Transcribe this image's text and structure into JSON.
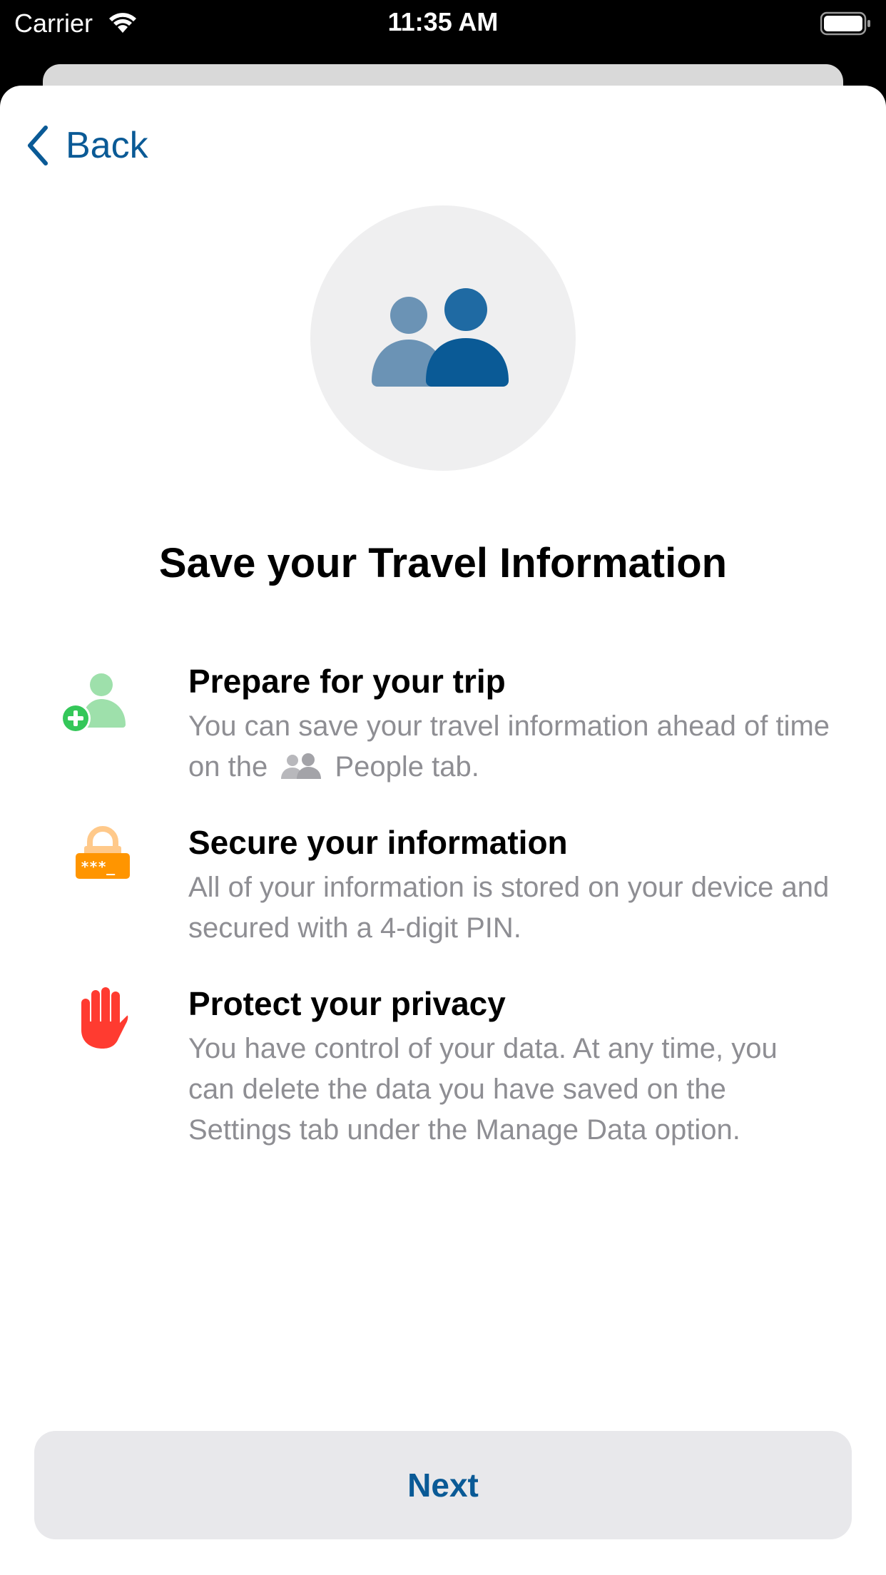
{
  "status_bar": {
    "carrier": "Carrier",
    "time": "11:35 AM"
  },
  "nav": {
    "back_label": "Back"
  },
  "hero": {
    "icon": "people-icon"
  },
  "page": {
    "title": "Save your Travel Information"
  },
  "features": [
    {
      "icon": "add-person-icon",
      "title": "Prepare for your trip",
      "desc_before": "You can save your travel information ahead of time on the",
      "desc_inline_icon": "people-icon",
      "desc_after": "People tab."
    },
    {
      "icon": "pin-lock-icon",
      "title": "Secure your information",
      "desc": "All of your information is stored on your device and secured with a 4-digit PIN."
    },
    {
      "icon": "stop-hand-icon",
      "title": "Protect your privacy",
      "desc": "You have control of your data. At any time, you can delete the data you have saved on the Settings tab under the Manage Data option."
    }
  ],
  "actions": {
    "next_label": "Next"
  },
  "colors": {
    "accent": "#0a5a96",
    "hero_person_back": "#6b93b5",
    "hero_person_front": "#0a5a96",
    "add_person": "#34c759",
    "lock": "#ff9500",
    "hand": "#ff3b30",
    "secondary_text": "#8e8e93"
  }
}
